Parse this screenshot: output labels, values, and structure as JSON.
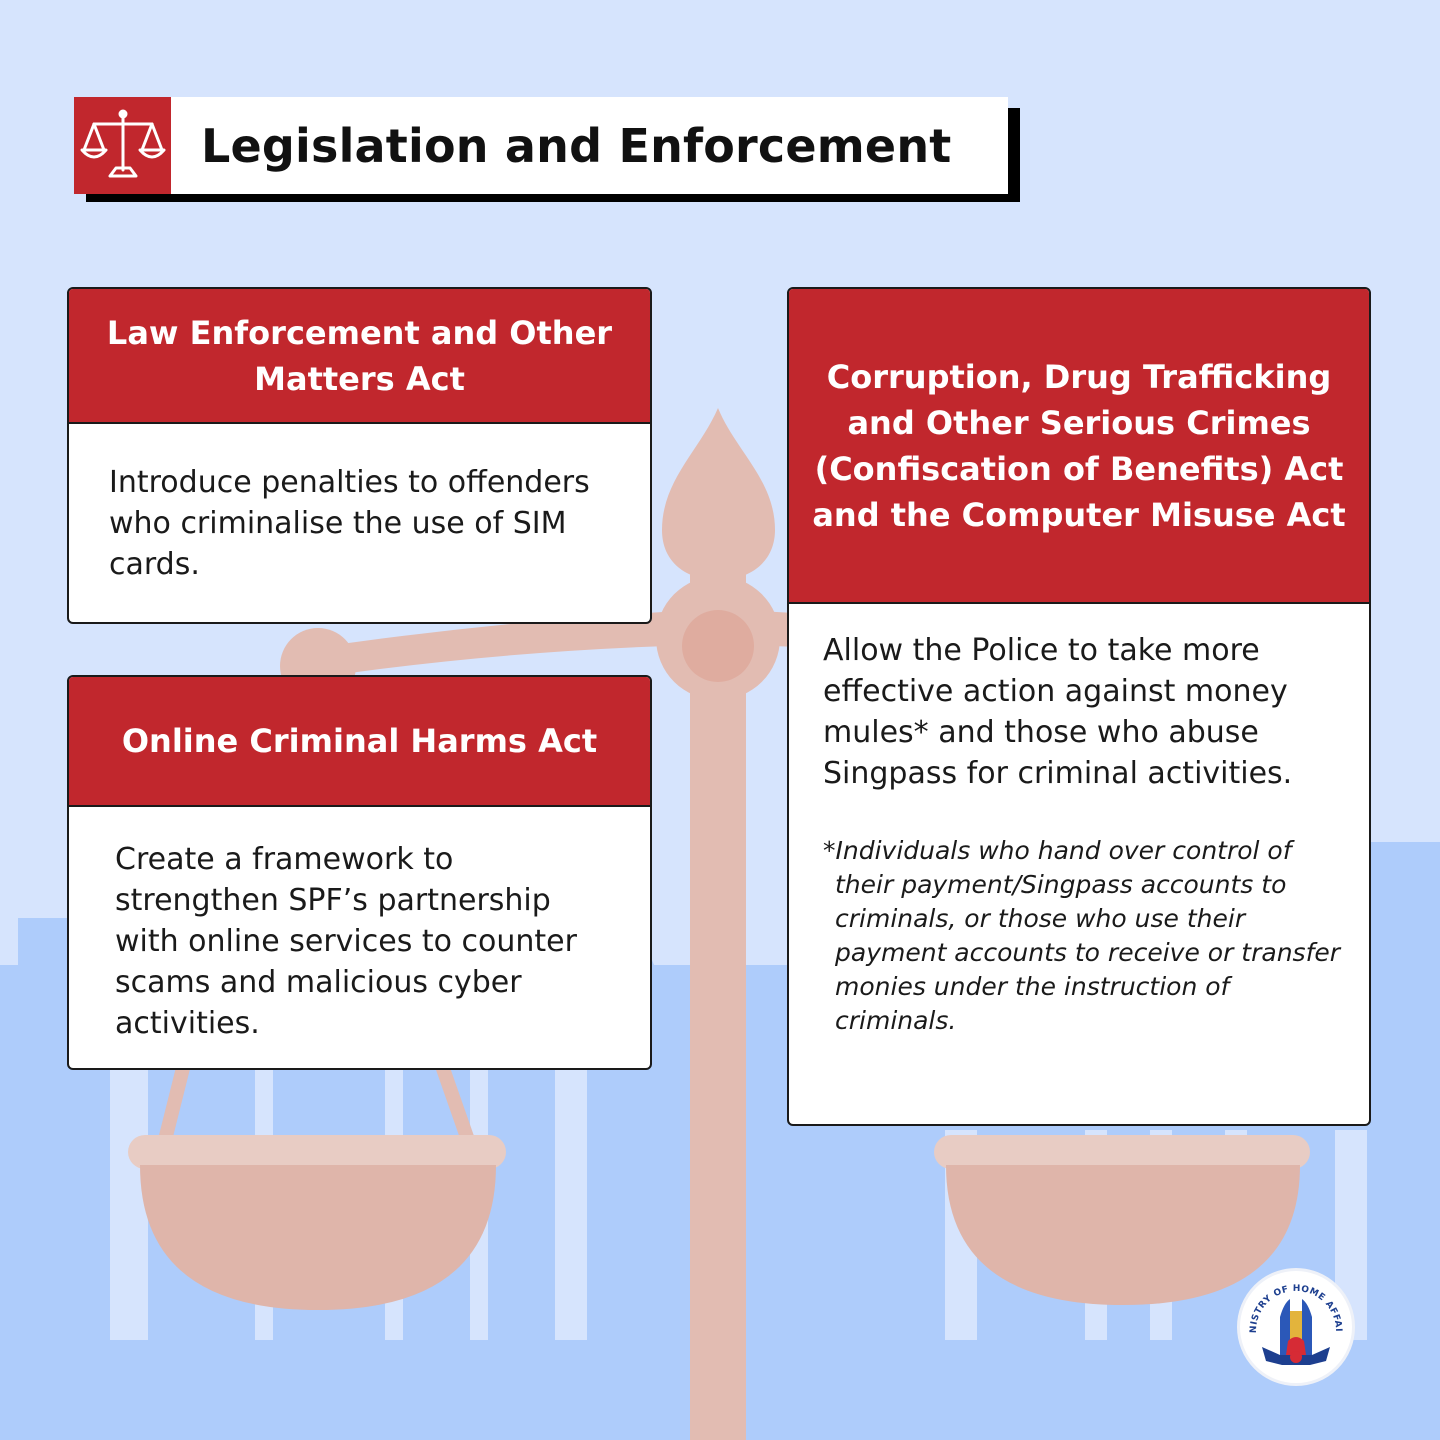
{
  "header": {
    "title": "Legislation and Enforcement",
    "icon": "scales-icon"
  },
  "cards": [
    {
      "title": "Law Enforcement and Other Matters Act",
      "body": "Introduce penalties to offenders who criminalise the use of SIM cards."
    },
    {
      "title": "Online Criminal Harms Act",
      "body": "Create a framework to strengthen SPF’s partnership with online services to counter scams and malicious cyber activities."
    },
    {
      "title": "Corruption, Drug Trafficking and Other Serious Crimes (Confiscation of Benefits) Act and the Computer Misuse Act",
      "body": "Allow the Police to take more effective action against money mules* and those who abuse Singpass for criminal activities.",
      "footnote": "*Individuals who hand over control of their payment/Singpass accounts to criminals, or those who use their payment accounts to receive or transfer monies under the instruction of criminals."
    }
  ],
  "seal": {
    "text": "MINISTRY OF HOME AFFAIRS"
  },
  "colors": {
    "accent_red": "#c1272d",
    "background": "#d6e4fd",
    "buildings": "#aeccfb",
    "scale": "#e2bcb2"
  }
}
